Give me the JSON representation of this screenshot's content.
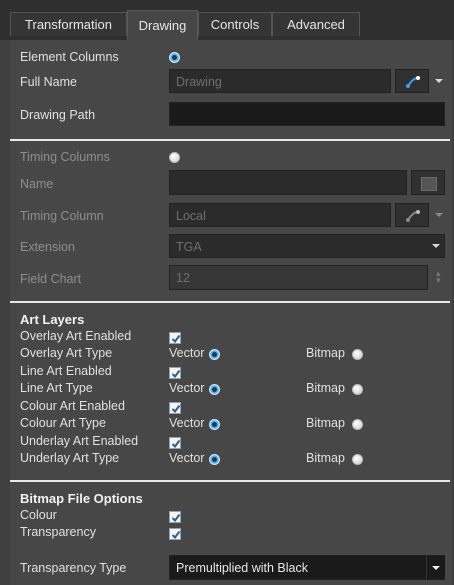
{
  "tabs": [
    {
      "label": "Transformation",
      "active": false
    },
    {
      "label": "Drawing",
      "active": true
    },
    {
      "label": "Controls",
      "active": false
    },
    {
      "label": "Advanced",
      "active": false
    }
  ],
  "element": {
    "columns_label": "Element Columns",
    "full_name_label": "Full Name",
    "full_name_value": "Drawing",
    "drawing_path_label": "Drawing Path",
    "drawing_path_value": ""
  },
  "timing": {
    "columns_label": "Timing Columns",
    "name_label": "Name",
    "name_value": "",
    "timing_column_label": "Timing Column",
    "timing_column_value": "Local",
    "extension_label": "Extension",
    "extension_value": "TGA",
    "field_chart_label": "Field Chart",
    "field_chart_value": "12"
  },
  "art_layers": {
    "title": "Art Layers",
    "rows": [
      {
        "label": "Overlay Art Enabled"
      },
      {
        "label": "Overlay Art Type",
        "vector": "Vector",
        "bitmap": "Bitmap"
      },
      {
        "label": "Line Art Enabled"
      },
      {
        "label": "Line Art Type",
        "vector": "Vector",
        "bitmap": "Bitmap"
      },
      {
        "label": "Colour Art Enabled"
      },
      {
        "label": "Colour Art Type",
        "vector": "Vector",
        "bitmap": "Bitmap"
      },
      {
        "label": "Underlay Art Enabled"
      },
      {
        "label": "Underlay Art Type",
        "vector": "Vector",
        "bitmap": "Bitmap"
      }
    ]
  },
  "bitmap": {
    "title": "Bitmap File Options",
    "colour_label": "Colour",
    "transparency_label": "Transparency",
    "transparency_type_label": "Transparency Type",
    "transparency_type_value": "Premultiplied with Black"
  },
  "icons": {
    "link": "link-icon",
    "dropdown": "chevron-down-icon",
    "spin": "spinner-icon",
    "square": "square-icon"
  }
}
